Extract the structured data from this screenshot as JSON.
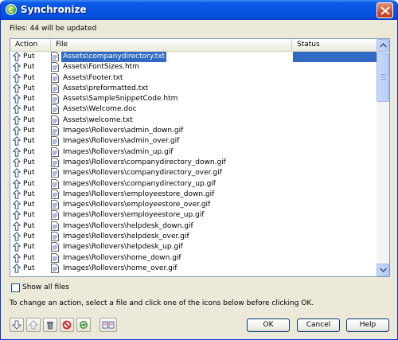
{
  "window": {
    "title": "Synchronize",
    "icon": "synchronize-icon"
  },
  "summary": "Files: 44 will be updated",
  "columns": {
    "action": "Action",
    "file": "File",
    "status": "Status"
  },
  "rows": [
    {
      "action": "Put",
      "file": "Assets\\companydirectory.txt",
      "status": "",
      "selected": true
    },
    {
      "action": "Put",
      "file": "Assets\\FontSizes.htm",
      "status": ""
    },
    {
      "action": "Put",
      "file": "Assets\\Footer.txt",
      "status": ""
    },
    {
      "action": "Put",
      "file": "Assets\\preformatted.txt",
      "status": ""
    },
    {
      "action": "Put",
      "file": "Assets\\SampleSnippetCode.htm",
      "status": ""
    },
    {
      "action": "Put",
      "file": "Assets\\Welcome.doc",
      "status": ""
    },
    {
      "action": "Put",
      "file": "Assets\\welcome.txt",
      "status": ""
    },
    {
      "action": "Put",
      "file": "Images\\Rollovers\\admin_down.gif",
      "status": ""
    },
    {
      "action": "Put",
      "file": "Images\\Rollovers\\admin_over.gif",
      "status": ""
    },
    {
      "action": "Put",
      "file": "Images\\Rollovers\\admin_up.gif",
      "status": ""
    },
    {
      "action": "Put",
      "file": "Images\\Rollovers\\companydirectory_down.gif",
      "status": ""
    },
    {
      "action": "Put",
      "file": "Images\\Rollovers\\companydirectory_over.gif",
      "status": ""
    },
    {
      "action": "Put",
      "file": "Images\\Rollovers\\companydirectory_up.gif",
      "status": ""
    },
    {
      "action": "Put",
      "file": "Images\\Rollovers\\employeestore_down.gif",
      "status": ""
    },
    {
      "action": "Put",
      "file": "Images\\Rollovers\\employeestore_over.gif",
      "status": ""
    },
    {
      "action": "Put",
      "file": "Images\\Rollovers\\employeestore_up.gif",
      "status": ""
    },
    {
      "action": "Put",
      "file": "Images\\Rollovers\\helpdesk_down.gif",
      "status": ""
    },
    {
      "action": "Put",
      "file": "Images\\Rollovers\\helpdesk_over.gif",
      "status": ""
    },
    {
      "action": "Put",
      "file": "Images\\Rollovers\\helpdesk_up.gif",
      "status": ""
    },
    {
      "action": "Put",
      "file": "Images\\Rollovers\\home_down.gif",
      "status": ""
    },
    {
      "action": "Put",
      "file": "Images\\Rollovers\\home_over.gif",
      "status": ""
    }
  ],
  "show_all_files": {
    "label": "Show all files",
    "checked": false
  },
  "hint": "To change an action, select a file and click one of the icons below before clicking OK.",
  "toolbar": [
    {
      "icon": "get-arrow-down-icon"
    },
    {
      "icon": "put-arrow-up-icon"
    },
    {
      "icon": "delete-trash-icon"
    },
    {
      "icon": "ignore-no-icon"
    },
    {
      "icon": "synchronized-icon"
    },
    {
      "icon": "compare-icon"
    }
  ],
  "buttons": {
    "ok": "OK",
    "cancel": "Cancel",
    "help": "Help"
  },
  "colors": {
    "selection": "#316ac5",
    "titlebar": "#0454e2",
    "dialog": "#ece9d8"
  }
}
